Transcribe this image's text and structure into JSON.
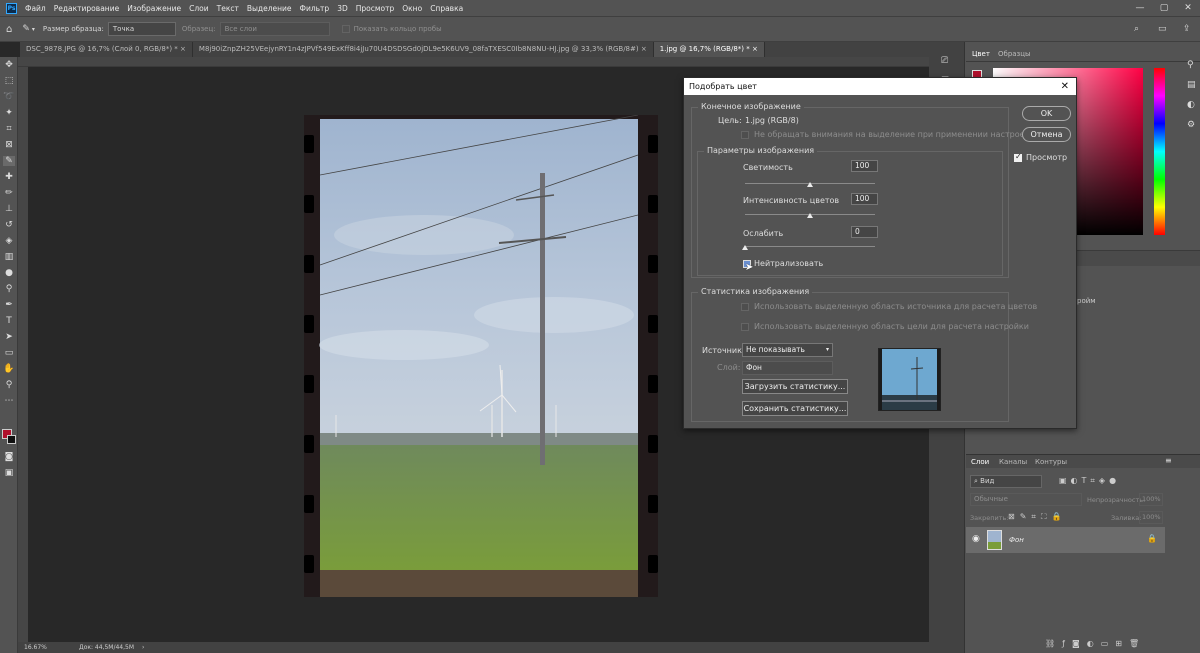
{
  "menu": {
    "logo": "Ps",
    "items": [
      "Файл",
      "Редактирование",
      "Изображение",
      "Слои",
      "Текст",
      "Выделение",
      "Фильтр",
      "3D",
      "Просмотр",
      "Окно",
      "Справка"
    ]
  },
  "options": {
    "sample_size_label": "Размер образца:",
    "sample_size_value": "Точка",
    "sample_label": "Образец:",
    "sample_value": "Все слои",
    "ring_label": "Показать кольцо пробы"
  },
  "tabs": [
    "DSC_9878.JPG @ 16,7% (Слой 0, RGB/8*) *",
    "M8j90iZnpZH25VEejynRY1n4zJPVf549ExKff8i4jJu70U4DSDSGd0jDL9e5K6UV9_08faTXESC0Ib8N8NU-HJ.jpg @ 33,3% (RGB/8#)",
    "1.jpg @ 16,7% (RGB/8*) *"
  ],
  "status": {
    "zoom": "16.67%",
    "doc": "Док: 44,5M/44,5M"
  },
  "dialog": {
    "title": "Подобрать цвет",
    "dest_group": "Конечное изображение",
    "target_label": "Цель:",
    "target_value": "1.jpg (RGB/8)",
    "ignore_sel": "Не обращать внимания на выделение при применении настроек",
    "params_group": "Параметры изображения",
    "luminance_label": "Светимость",
    "luminance_value": "100",
    "intensity_label": "Интенсивность цветов",
    "intensity_value": "100",
    "fade_label": "Ослабить",
    "fade_value": "0",
    "neutralize_label": "Нейтрализовать",
    "stats_group": "Статистика изображения",
    "use_src_sel": "Использовать выделенную область источника для расчета цветов",
    "use_tgt_sel": "Использовать выделенную область цели для расчета настройки",
    "source_label": "Источник:",
    "source_value": "Не показывать",
    "layer_label": "Слой:",
    "layer_value": "Фон",
    "load_btn": "Загрузить статистику...",
    "save_btn": "Сохранить статистику...",
    "ok": "OK",
    "cancel": "Отмена",
    "preview": "Просмотр",
    "luminance_fraction": 0.5,
    "intensity_fraction": 0.5,
    "fade_fraction": 0.0
  },
  "panels": {
    "color_tabs": [
      "Цвет",
      "Образцы"
    ],
    "layers_tabs": [
      "Слои",
      "Каналы",
      "Контуры"
    ],
    "kind_placeholder": "Вид",
    "blend_mode": "Обычные",
    "opacity_label": "Непрозрачность:",
    "opacity_value": "100%",
    "lock_label": "Закрепить:",
    "fill_label": "Заливка:",
    "fill_value": "100%",
    "layer_name": "Фон",
    "partial_text": "ройм"
  },
  "colors": {
    "accent": "#31a8ff",
    "foreground": "#b0102c"
  }
}
